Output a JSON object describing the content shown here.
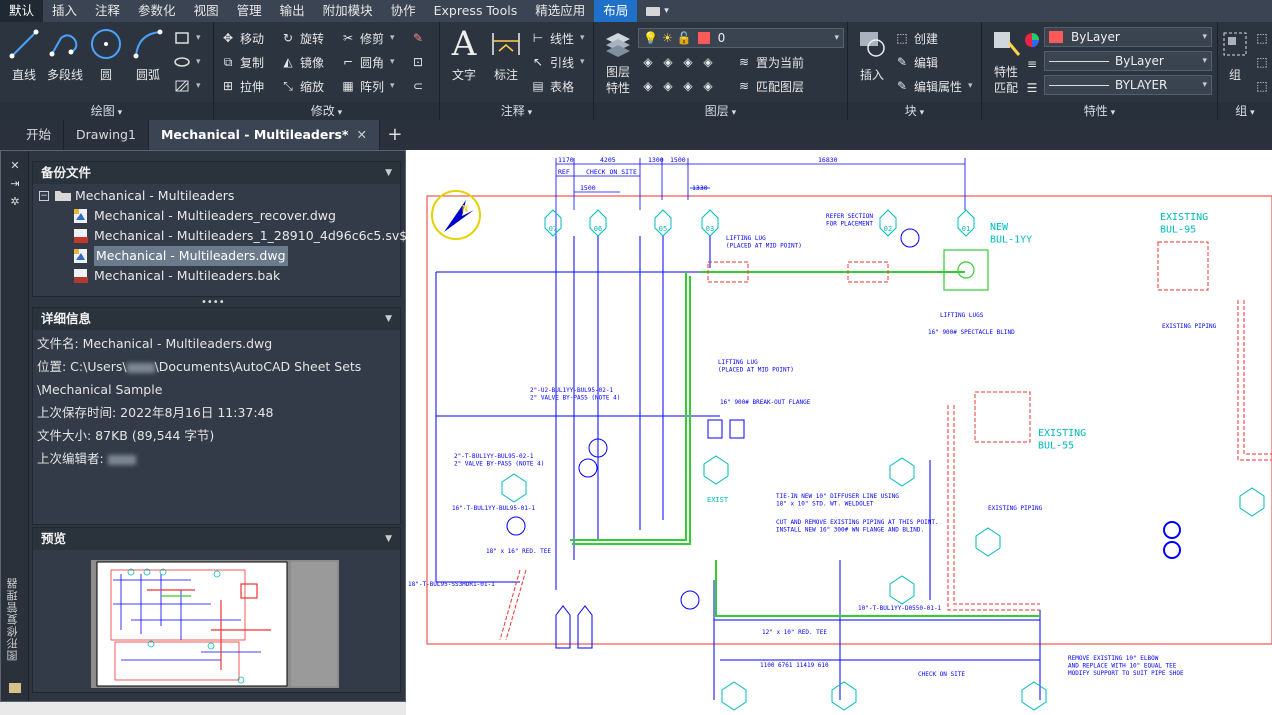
{
  "menu": {
    "tabs": [
      "默认",
      "插入",
      "注释",
      "参数化",
      "视图",
      "管理",
      "输出",
      "附加模块",
      "协作",
      "Express Tools",
      "精选应用",
      "布局"
    ],
    "active_tab": "默认",
    "highlight_tab": "布局"
  },
  "ribbon": {
    "draw": {
      "title": "绘图",
      "line": "直线",
      "polyline": "多段线",
      "circle": "圆",
      "arc": "圆弧"
    },
    "modify": {
      "title": "修改",
      "move": "移动",
      "rotate": "旋转",
      "trim": "修剪",
      "copy": "复制",
      "mirror": "镜像",
      "fillet": "圆角",
      "stretch": "拉伸",
      "scale": "缩放",
      "array": "阵列"
    },
    "annotation": {
      "title": "注释",
      "text": "文字",
      "dimension": "标注",
      "linear": "线性",
      "leader": "引线",
      "table": "表格"
    },
    "layers": {
      "title": "图层",
      "properties": "图层\n特性",
      "layer_value": "0",
      "set_current": "置为当前",
      "match_layer": "匹配图层"
    },
    "block": {
      "title": "块",
      "insert": "插入",
      "create": "创建",
      "edit": "编辑",
      "edit_attr": "编辑属性"
    },
    "properties": {
      "title": "特性",
      "match": "特性\n匹配",
      "color": "ByLayer",
      "linetype": "ByLayer",
      "lineweight": "BYLAYER"
    },
    "group": {
      "title": "组",
      "group": "组"
    }
  },
  "doc_tabs": [
    "开始",
    "Drawing1",
    "Mechanical - Multileaders*"
  ],
  "palette": {
    "side_title": "图形修复管理器",
    "backup": {
      "title": "备份文件",
      "root": "Mechanical - Multileaders",
      "files": [
        {
          "name": "Mechanical - Multileaders_recover.dwg",
          "icon": "dwg"
        },
        {
          "name": "Mechanical - Multileaders_1_28910_4d96c6c5.sv$",
          "icon": "svs"
        },
        {
          "name": "Mechanical - Multileaders.dwg",
          "icon": "dwg",
          "selected": true
        },
        {
          "name": "Mechanical - Multileaders.bak",
          "icon": "bak"
        }
      ]
    },
    "details": {
      "title": "详细信息",
      "filename": "文件名: Mechanical - Multileaders.dwg",
      "location1": "位置: C:\\Users\\",
      "location1b": "\\Documents\\AutoCAD Sheet Sets",
      "location2": "\\Mechanical Sample",
      "saved": "上次保存时间: 2022年8月16日   11:37:48",
      "size": "文件大小: 87KB (89,544 字节)",
      "editor": "上次编辑者: "
    },
    "preview": {
      "title": "预览"
    }
  },
  "drawing": {
    "top_dims": [
      "1170",
      "4205",
      "1300",
      "1500",
      "16830",
      "REF",
      "CHECK ON SITE",
      "1500",
      "1330"
    ],
    "tags": [
      "07",
      "06",
      "05",
      "03",
      "02",
      "01"
    ],
    "tag_sub": "PS BUL1YY",
    "notes": {
      "new": "NEW\nBUL-1YY",
      "existing_95": "EXISTING\nBUL-95",
      "existing_55": "EXISTING\nBUL-55",
      "refer": "REFER SECTION\nFOR PLACEMENT",
      "lifting_lug1": "LIFTING LUG\n(PLACED AT MID POINT)",
      "lifting_lugs": "LIFTING LUGS",
      "spectacle": "16\" 900# SPECTACLE BLIND",
      "lifting_lug2": "LIFTING LUG\n(PLACED AT MID POINT)",
      "breakout": "16\" 900# BREAK-OUT FLANGE",
      "valve1": "2\"-U2-BUL1YY-BUL95-02-1\n2\" VALVE BY-PASS (NOTE 4)",
      "valve2": "2\"-T-BUL1YY-BUL95-02-1\n2\" VALVE BY-PASS (NOTE 4)",
      "line16": "16\"-T-BUL1YY-BUL95-01-1",
      "red_tee1": "18\" x 16\" RED. TEE",
      "line18": "18\"-T-BUL95-SS3HDR1-01-1",
      "tie_in": "TIE-IN NEW 10\" DIFFUSER LINE USING\n18\" x 10\" STD. WT. WELDOLET",
      "cut_remove": "CUT AND REMOVE EXISTING PIPING AT THIS POINT.\nINSTALL NEW 16\" 300# WN FLANGE AND BLIND.",
      "existing_piping": "EXISTING PIPING",
      "red_tee2": "12\" x 10\" RED. TEE",
      "line10": "10\"-T-BUL1YY-D0550-01-1",
      "remove_elbow": "REMOVE EXISTING 10\" ELBOW\nAND REPLACE WITH 10\" EQUAL TEE\nMODIFY SUPPORT TO SUIT PIPE SHOE",
      "bottom_dims": "1100   6761   11419   610",
      "check": "CHECK ON SITE",
      "exist": "EXIST"
    }
  },
  "colors": {
    "menubar": "#3b4453",
    "ribbon": "#2c3440",
    "highlight": "#1e70c8",
    "blue": "#0000ff",
    "cyan": "#00c8c8",
    "red": "#e23c3c",
    "green": "#3ec83e"
  }
}
